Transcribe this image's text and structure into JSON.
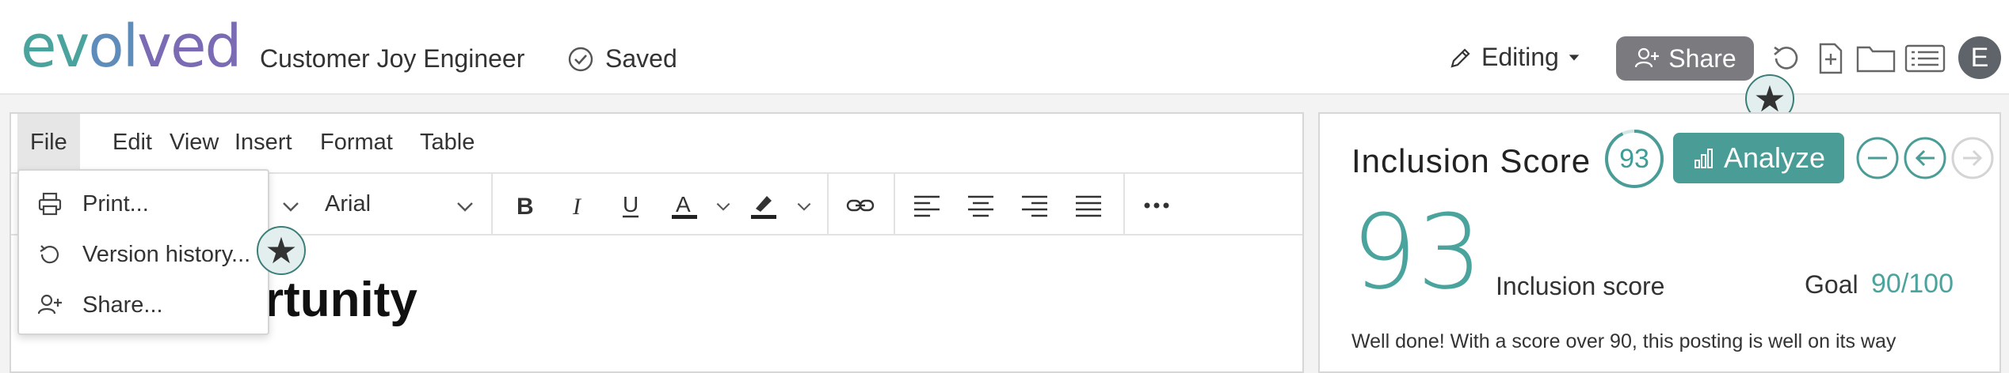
{
  "app": {
    "logo_text": "evolved",
    "doc_title": "Customer Joy Engineer",
    "saved_label": "Saved",
    "editing_label": "Editing",
    "share_label": "Share",
    "avatar_initial": "E"
  },
  "menubar": {
    "items": [
      "File",
      "Edit",
      "View",
      "Insert",
      "Format",
      "Table"
    ]
  },
  "toolbar": {
    "font_family": "Arial"
  },
  "file_menu": {
    "items": [
      {
        "label": "Print...",
        "icon": "printer-icon"
      },
      {
        "label": "Version history...",
        "icon": "history-icon"
      },
      {
        "label": "Share...",
        "icon": "add-user-icon"
      }
    ]
  },
  "document": {
    "visible_heading_fragment": "rtunity"
  },
  "panel": {
    "title": "Inclusion Score",
    "ring_score": "93",
    "analyze_label": "Analyze",
    "big_score": "93",
    "score_label": "Inclusion score",
    "goal_label": "Goal",
    "goal_value": "90/100",
    "message": "Well done! With a score over 90, this posting is well on its way"
  },
  "badges": {
    "star_glyph": "★"
  },
  "colors": {
    "accent": "#4a9d97",
    "share_button": "#7a7a7f",
    "avatar": "#5f646b"
  }
}
